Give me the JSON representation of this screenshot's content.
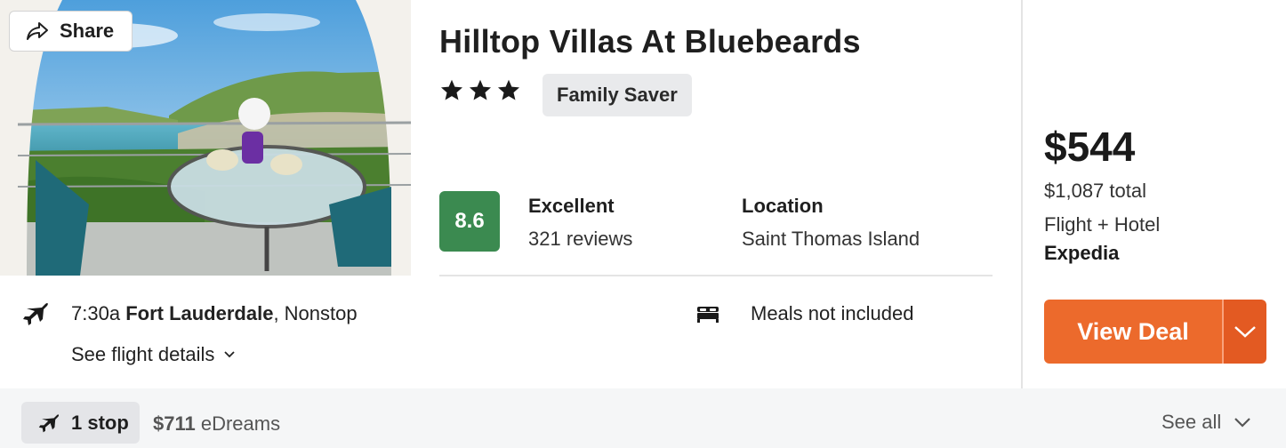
{
  "share": {
    "label": "Share",
    "icon": "share-arrow-icon"
  },
  "hotel": {
    "name": "Hilltop Villas At Bluebeards",
    "stars": 3,
    "badge": "Family Saver",
    "score": "8.6",
    "score_color": "#3b8a50",
    "rating_label": "Excellent",
    "reviews": "321 reviews",
    "location_label": "Location",
    "location": "Saint Thomas Island"
  },
  "flight": {
    "time": "7:30a",
    "origin": "Fort Lauderdale",
    "stops": ", Nonstop",
    "details_link": "See flight details",
    "meals": "Meals not included"
  },
  "pricing": {
    "price": "$544",
    "total": "$1,087 total",
    "package": "Flight + Hotel",
    "provider": "Expedia",
    "cta": "View Deal",
    "cta_color": "#ec6a2c"
  },
  "alternate": {
    "stops_label": "1 stop",
    "price": "$711",
    "provider": " eDreams",
    "see_all": "See all"
  }
}
